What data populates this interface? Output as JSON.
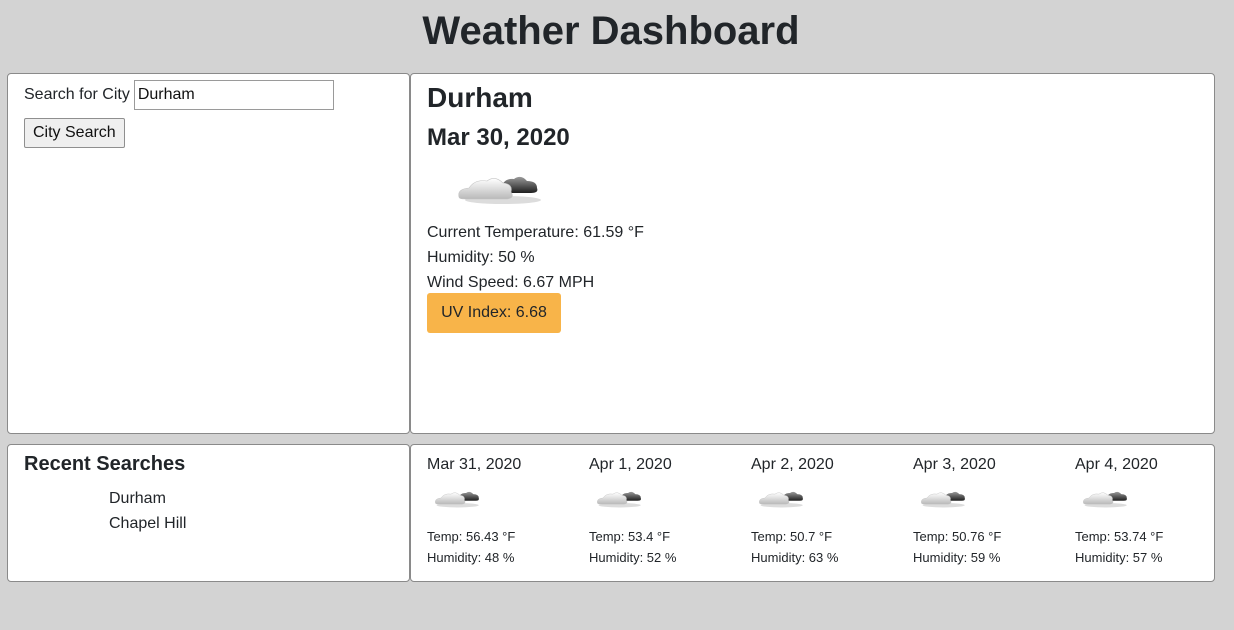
{
  "header": {
    "title": "Weather Dashboard"
  },
  "search": {
    "label": "Search for City",
    "input_value": "Durham",
    "button_label": "City Search"
  },
  "current": {
    "city": "Durham",
    "date": "Mar 30, 2020",
    "icon": "cloudy-icon",
    "temperature": "Current Temperature: 61.59 °F",
    "humidity": "Humidity: 50 %",
    "wind": "Wind Speed: 6.67 MPH",
    "uv": "UV Index: 6.68",
    "uv_color": "#f8b449"
  },
  "recent": {
    "title": "Recent Searches",
    "items": [
      "Durham",
      "Chapel Hill"
    ]
  },
  "forecast": [
    {
      "date": "Mar 31, 2020",
      "icon": "cloudy-icon",
      "temp": "Temp: 56.43 °F",
      "humidity": "Humidity: 48 %"
    },
    {
      "date": "Apr 1, 2020",
      "icon": "cloudy-icon",
      "temp": "Temp: 53.4 °F",
      "humidity": "Humidity: 52 %"
    },
    {
      "date": "Apr 2, 2020",
      "icon": "cloudy-icon",
      "temp": "Temp: 50.7 °F",
      "humidity": "Humidity: 63 %"
    },
    {
      "date": "Apr 3, 2020",
      "icon": "cloudy-icon",
      "temp": "Temp: 50.76 °F",
      "humidity": "Humidity: 59 %"
    },
    {
      "date": "Apr 4, 2020",
      "icon": "cloudy-icon",
      "temp": "Temp: 53.74 °F",
      "humidity": "Humidity: 57 %"
    }
  ],
  "colors": {
    "background": "#d3d3d3",
    "card": "#ffffff",
    "accent": "#f8b449"
  }
}
